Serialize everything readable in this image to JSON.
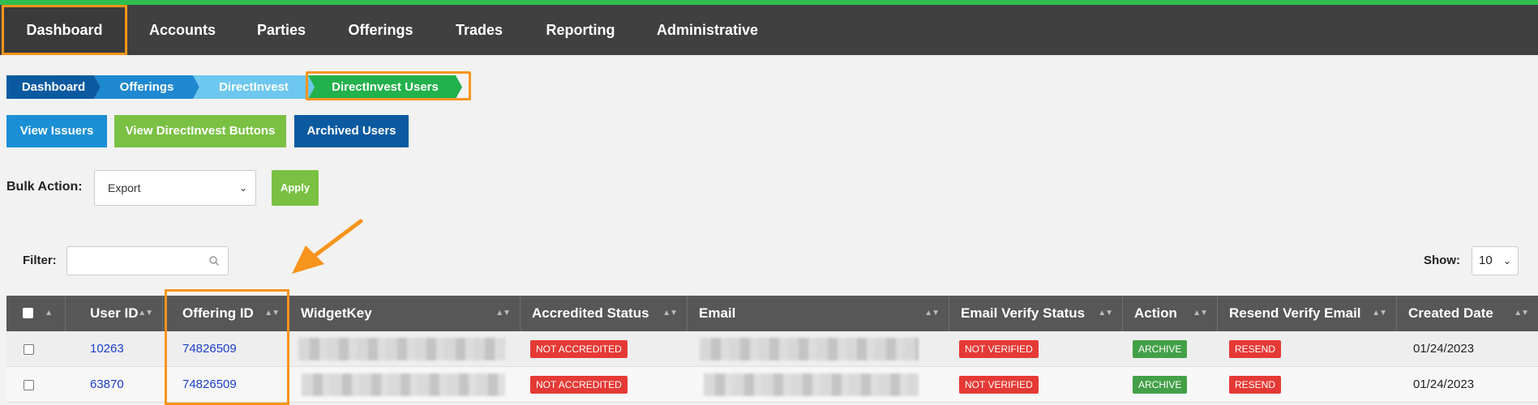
{
  "nav": {
    "items": [
      "Dashboard",
      "Accounts",
      "Parties",
      "Offerings",
      "Trades",
      "Reporting",
      "Administrative"
    ]
  },
  "breadcrumb": [
    "Dashboard",
    "Offerings",
    "DirectInvest",
    "DirectInvest Users"
  ],
  "buttons": {
    "view_issuers": "View Issuers",
    "view_directinvest": "View DirectInvest Buttons",
    "archived_users": "Archived Users"
  },
  "bulk": {
    "label": "Bulk Action:",
    "selected": "Export",
    "apply": "Apply"
  },
  "filter": {
    "label": "Filter:",
    "value": ""
  },
  "show": {
    "label": "Show:",
    "selected": "10"
  },
  "table": {
    "columns": [
      "User ID",
      "Offering ID",
      "WidgetKey",
      "Accredited Status",
      "Email",
      "Email Verify Status",
      "Action",
      "Resend Verify Email",
      "Created Date"
    ],
    "rows": [
      {
        "user_id": "10263",
        "offering_id": "74826509",
        "accredited": "NOT ACCREDITED",
        "verify": "NOT VERIFIED",
        "action": "ARCHIVE",
        "resend": "RESEND",
        "created": "01/24/2023"
      },
      {
        "user_id": "63870",
        "offering_id": "74826509",
        "accredited": "NOT ACCREDITED",
        "verify": "NOT VERIFIED",
        "action": "ARCHIVE",
        "resend": "RESEND",
        "created": "01/24/2023"
      }
    ]
  },
  "colors": {
    "accent_highlight": "#f7941d",
    "top_border": "#2ebd4e",
    "badge_red": "#e53935",
    "badge_green": "#43a047"
  }
}
